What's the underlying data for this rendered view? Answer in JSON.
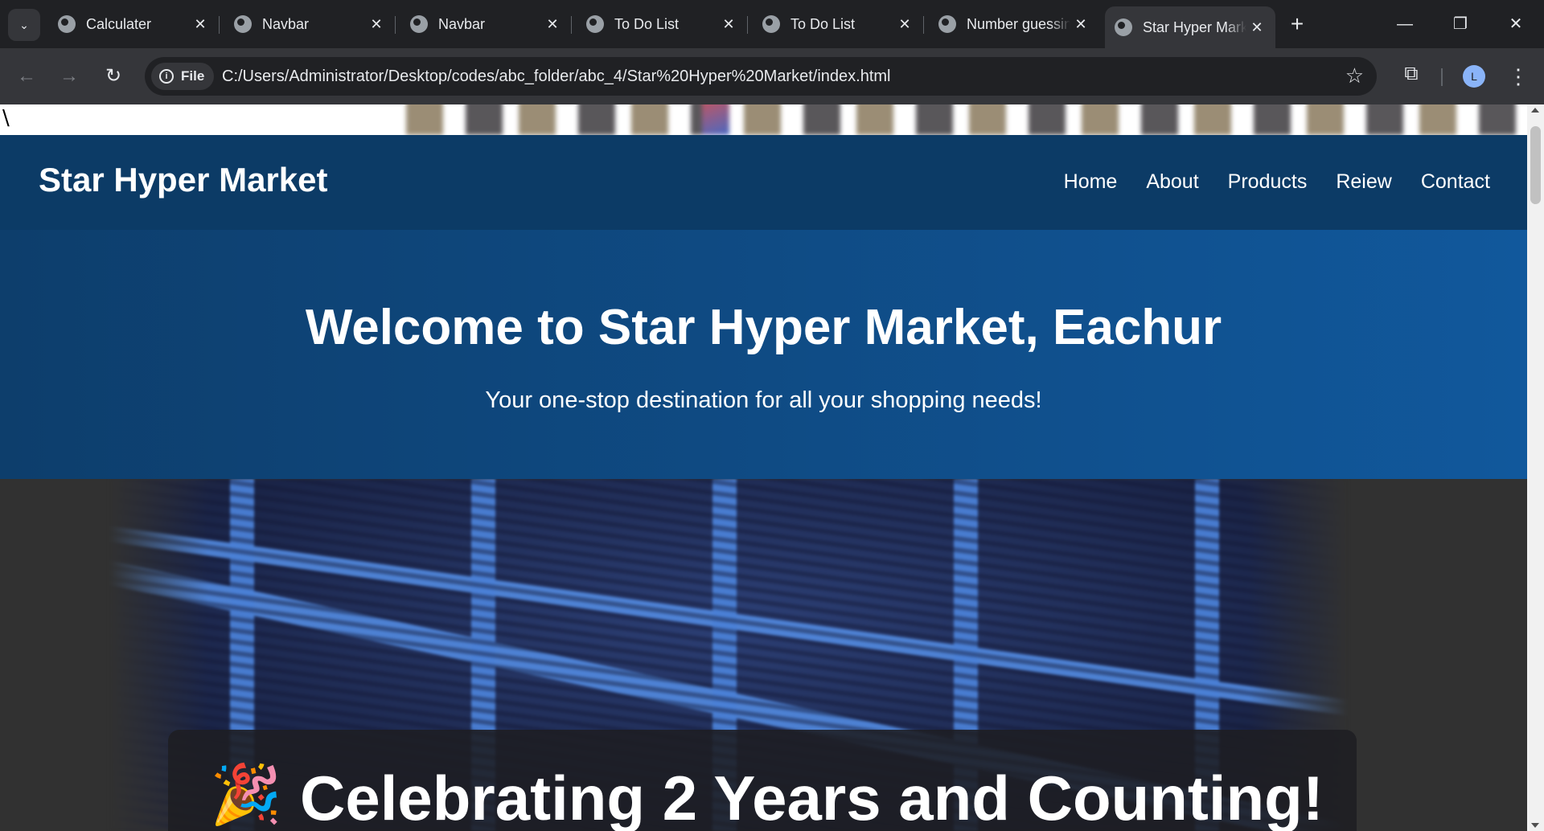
{
  "browser": {
    "tabs": [
      {
        "title": "Calculater",
        "active": false
      },
      {
        "title": "Navbar",
        "active": false
      },
      {
        "title": "Navbar",
        "active": false
      },
      {
        "title": "To Do List",
        "active": false
      },
      {
        "title": "To Do List",
        "active": false
      },
      {
        "title": "Number guessing",
        "active": false
      },
      {
        "title": "Star Hyper Market",
        "active": true
      }
    ],
    "tab_close_glyph": "✕",
    "new_tab_glyph": "+",
    "window": {
      "minimize": "—",
      "restore": "❐",
      "close": "✕"
    },
    "back_glyph": "←",
    "forward_glyph": "→",
    "reload_glyph": "↻",
    "scheme_chip": "File",
    "url": "C:/Users/Administrator/Desktop/codes/abc_folder/abc_4/Star%20Hyper%20Market/index.html",
    "bookmark_glyph": "☆",
    "extensions_glyph": "⧉",
    "profile_initial": "L",
    "menu_glyph": "⋮"
  },
  "page": {
    "stray_text": "\\",
    "brand": "Star Hyper Market",
    "nav": [
      "Home",
      "About",
      "Products",
      "Reiew",
      "Contact"
    ],
    "hero": {
      "title": "Welcome to Star Hyper Market, Eachur",
      "subtitle": "Your one-stop destination for all your shopping needs!"
    },
    "banner": {
      "emoji": "🎉",
      "headline": "Celebrating 2 Years and Counting!"
    }
  },
  "colors": {
    "nav_bg": "#0c3b66",
    "hero_bg": "#11589c",
    "page_bg": "#313131",
    "browser_dark": "#202124",
    "browser_toolbar": "#35363a"
  }
}
